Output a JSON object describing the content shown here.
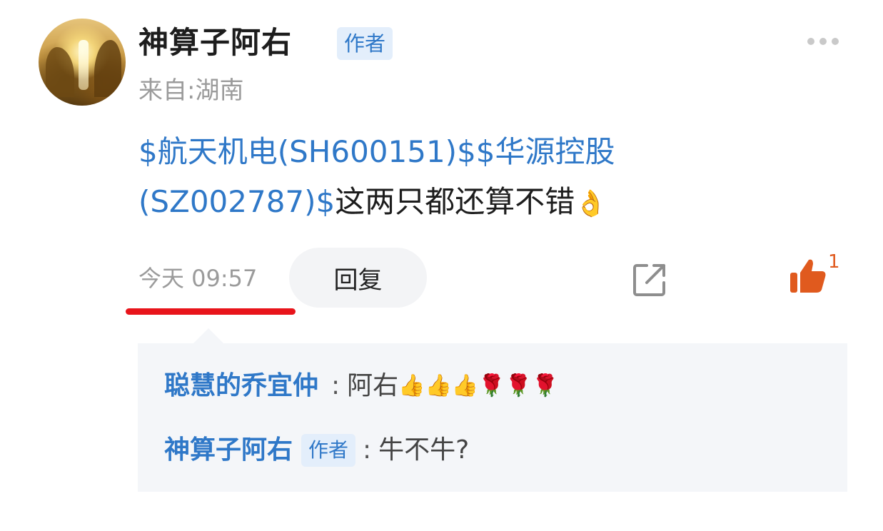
{
  "post": {
    "username": "神算子阿右",
    "author_badge": "作者",
    "location": "来自:湖南",
    "content_link1": "$航天机电(SH600151)$",
    "content_link2": "$华源控股(SZ002787)$",
    "content_text": "这两只都还算不错",
    "content_emoji": "👌",
    "time": "今天 09:57",
    "reply_label": "回复",
    "like_count": "1",
    "more_icon": "more-dots-icon",
    "share_icon": "share-icon",
    "like_icon": "thumbs-up-icon",
    "accent_color": "#2f78c8",
    "like_color": "#e05a1e"
  },
  "comments": [
    {
      "author": "聪慧的乔宜仲",
      "separator": ":",
      "text": "阿右",
      "emojis": "👍👍👍🌹🌹🌹"
    },
    {
      "author": "神算子阿右",
      "badge": "作者",
      "separator": ":",
      "text": "牛不牛?"
    }
  ]
}
